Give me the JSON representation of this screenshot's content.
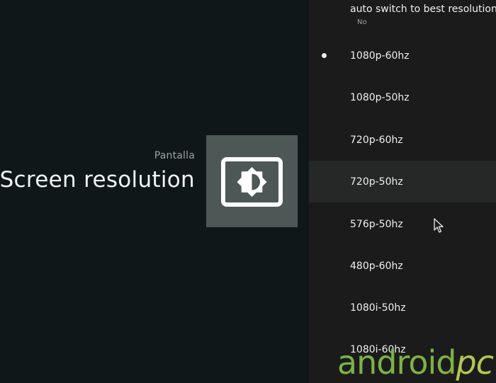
{
  "header": {
    "breadcrumb": "Pantalla",
    "title": "Screen resolution"
  },
  "auto_switch": {
    "title": "auto switch to best resolution",
    "value": "No"
  },
  "options": [
    {
      "label": "1080p-60hz",
      "selected": true
    },
    {
      "label": "1080p-50hz"
    },
    {
      "label": "720p-60hz"
    },
    {
      "label": "720p-50hz",
      "focused": true
    },
    {
      "label": "576p-50hz"
    },
    {
      "label": "480p-60hz"
    },
    {
      "label": "1080i-50hz"
    },
    {
      "label": "1080i-60hz"
    }
  ],
  "watermark": {
    "part1": "android",
    "part2": "pc"
  },
  "colors": {
    "left_background": "#0f1719",
    "right_background": "#1b1b1b",
    "focused_row": "#262828",
    "icon_tile": "#4d5756",
    "watermark_green": "#7cb342"
  },
  "icons": {
    "tile": "brightness-icon",
    "selection": "radio-selected-icon",
    "pointer": "mouse-cursor-icon"
  }
}
